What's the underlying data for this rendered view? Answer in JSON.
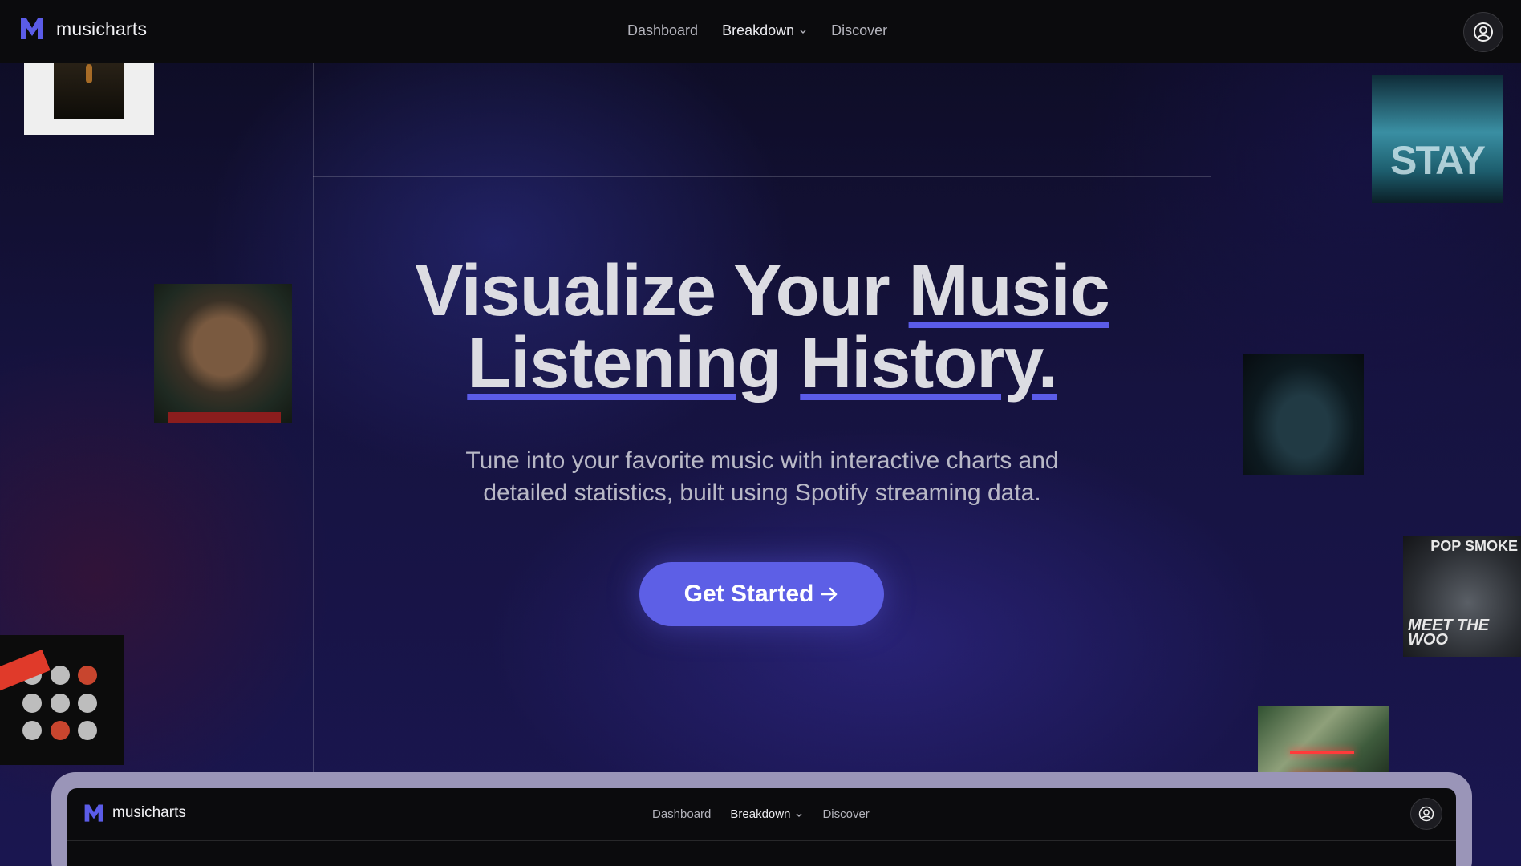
{
  "app": {
    "brand_name": "musicharts"
  },
  "nav": {
    "links": [
      {
        "label": "Dashboard"
      },
      {
        "label": "Breakdown"
      },
      {
        "label": "Discover"
      }
    ]
  },
  "hero": {
    "title_line1_plain": "Visualize Your ",
    "title_line1_underlined": "Music",
    "title_line2_word1": "Listening",
    "title_line2_word2": "History.",
    "subtitle": "Tune into your favorite music with interactive charts and detailed statistics, built using Spotify streaming data.",
    "cta_label": "Get Started"
  },
  "covers": {
    "stay_text": "STAY",
    "pop_smoke_text": "POP SMOKE",
    "meet_woo_text": "MEET THE WOO"
  },
  "preview": {
    "brand_name": "musicharts",
    "links": [
      {
        "label": "Dashboard"
      },
      {
        "label": "Breakdown"
      },
      {
        "label": "Discover"
      }
    ]
  },
  "colors": {
    "accent": "#5d5fe6",
    "nav_bg": "#0b0b0d"
  },
  "icons": [
    "m-logo-icon",
    "chevron-down-icon",
    "user-circle-icon",
    "arrow-right-icon"
  ]
}
